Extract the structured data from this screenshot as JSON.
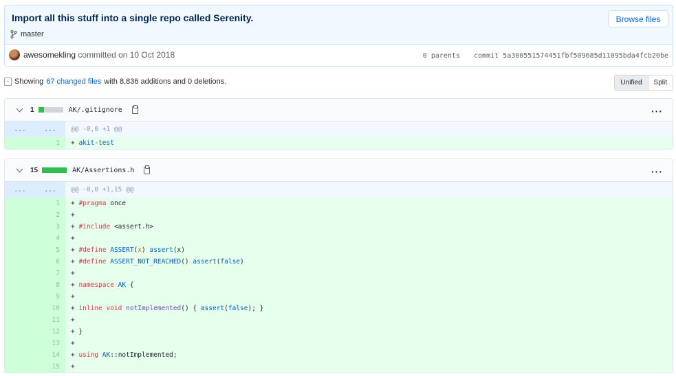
{
  "commit": {
    "title": "Import all this stuff into a single repo called Serenity.",
    "branch": "master",
    "browse_label": "Browse files",
    "author": "awesomekling",
    "committed_text": "committed on 10 Oct 2018",
    "parents_text": "0 parents",
    "commit_label": "commit",
    "sha": "5a300551574451fbf509685d11095bda4fcb20be"
  },
  "summary": {
    "showing": "Showing",
    "changed_files": "67 changed files",
    "with_text": "with 8,836 additions and 0 deletions."
  },
  "view_toggle": {
    "unified": "Unified",
    "split": "Split"
  },
  "files": [
    {
      "count": "1",
      "name": "AK/.gitignore",
      "hunk": "@@ -0,0 +1 @@",
      "hunk_ln": "...",
      "lines": [
        {
          "n": "1",
          "text": "+ akit-test"
        }
      ]
    },
    {
      "count": "15",
      "name": "AK/Assertions.h",
      "hunk": "@@ -0,0 +1,15 @@",
      "hunk_ln": "...",
      "lines": [
        {
          "n": "1",
          "text": "+ #pragma once"
        },
        {
          "n": "2",
          "text": "+"
        },
        {
          "n": "3",
          "text": "+ #include <assert.h>"
        },
        {
          "n": "4",
          "text": "+"
        },
        {
          "n": "5",
          "text": "+ #define ASSERT(x) assert(x)"
        },
        {
          "n": "6",
          "text": "+ #define ASSERT_NOT_REACHED() assert(false)"
        },
        {
          "n": "7",
          "text": "+"
        },
        {
          "n": "8",
          "text": "+ namespace AK {"
        },
        {
          "n": "9",
          "text": "+"
        },
        {
          "n": "10",
          "text": "+ inline void notImplemented() { assert(false); }"
        },
        {
          "n": "11",
          "text": "+"
        },
        {
          "n": "12",
          "text": "+ }"
        },
        {
          "n": "13",
          "text": "+"
        },
        {
          "n": "14",
          "text": "+ using AK::notImplemented;"
        },
        {
          "n": "15",
          "text": "+"
        }
      ]
    }
  ],
  "colors": {
    "addition": "#2cbe4e",
    "neutral": "#d1d5da",
    "link": "#0366d6"
  }
}
